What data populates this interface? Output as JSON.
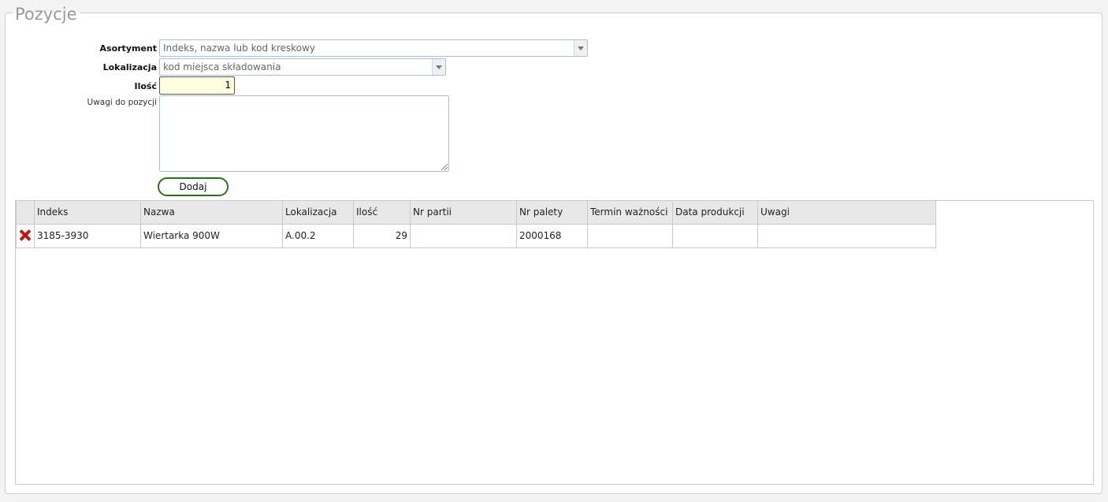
{
  "section": {
    "title": "Pozycje"
  },
  "form": {
    "asortyment_label": "Asortyment",
    "asortyment_placeholder": "Indeks, nazwa lub kod kreskowy",
    "lokalizacja_label": "Lokalizacja",
    "lokalizacja_placeholder": "kod miejsca składowania",
    "ilosc_label": "Ilość",
    "ilosc_value": "1",
    "uwagi_label": "Uwagi do pozycji",
    "uwagi_value": "",
    "add_button": "Dodaj"
  },
  "table": {
    "columns": [
      "Indeks",
      "Nazwa",
      "Lokalizacja",
      "Ilość",
      "Nr partii",
      "Nr palety",
      "Termin ważności",
      "Data produkcji",
      "Uwagi"
    ],
    "rows": [
      {
        "indeks": "3185-3930",
        "nazwa": "Wiertarka 900W",
        "lokalizacja": "A.00.2",
        "ilosc": "29",
        "nr_partii": "",
        "nr_palety": "2000168",
        "termin": "",
        "data_produkcji": "",
        "uwagi": ""
      }
    ]
  },
  "icons": {
    "delete": "delete-x-icon"
  },
  "colors": {
    "qty_bg": "#ffffe1",
    "button_border": "#2e6d1c",
    "delete_red": "#c01616"
  }
}
